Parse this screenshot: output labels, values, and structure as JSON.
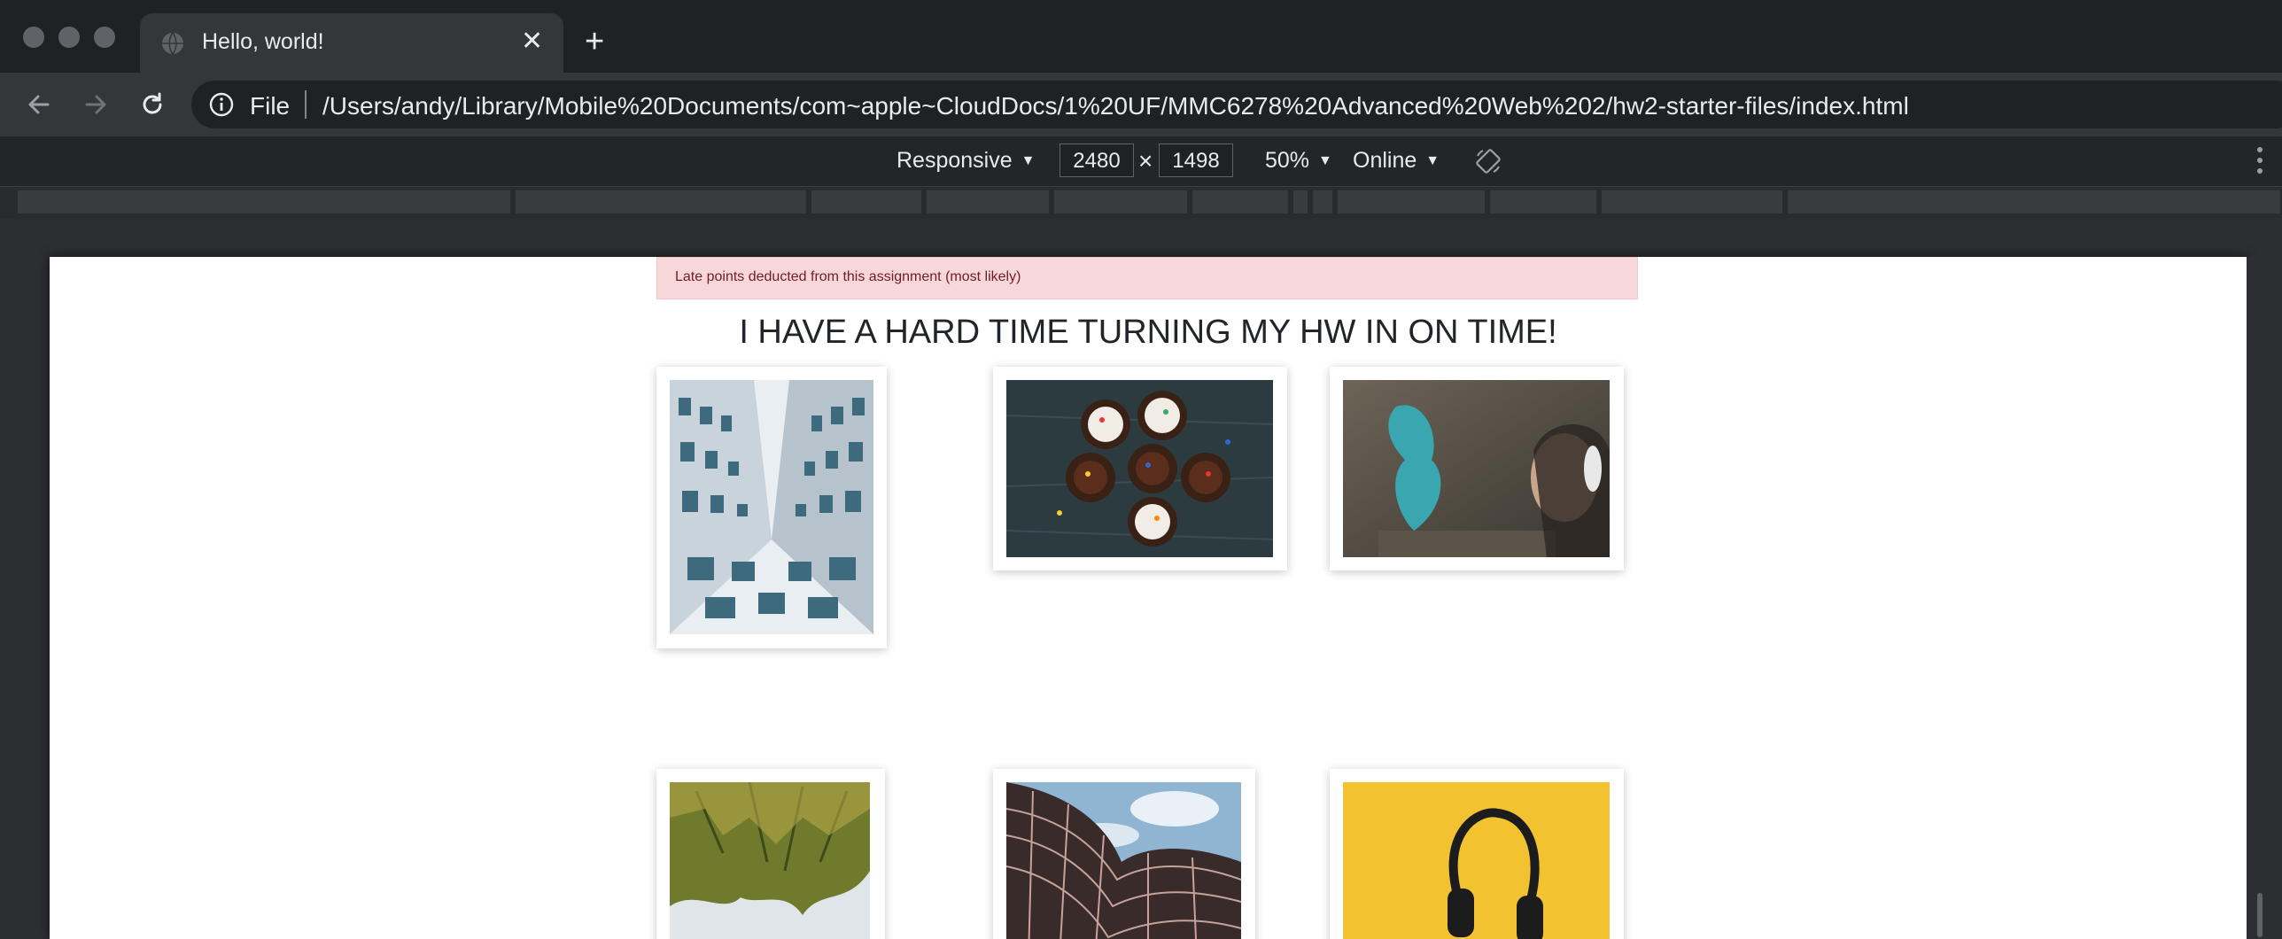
{
  "browser": {
    "tab": {
      "title": "Hello, world!"
    },
    "toolbar": {
      "scheme_label": "File",
      "url": "/Users/andy/Library/Mobile%20Documents/com~apple~CloudDocs/1%20UF/MMC6278%20Advanced%20Web%202/hw2-starter-files/index.html"
    },
    "device_toolbar": {
      "device": "Responsive",
      "width": "2480",
      "height": "1498",
      "separator": "×",
      "zoom": "50%",
      "throttling": "Online"
    }
  },
  "page": {
    "alert_text": "Late points deducted from this assignment (most likely)",
    "heading": "I HAVE A HARD TIME TURNING MY HW IN ON TIME!"
  },
  "colors": {
    "alert_bg": "#f8d7da",
    "alert_text": "#721c24",
    "browser_chrome": "#35363a"
  }
}
